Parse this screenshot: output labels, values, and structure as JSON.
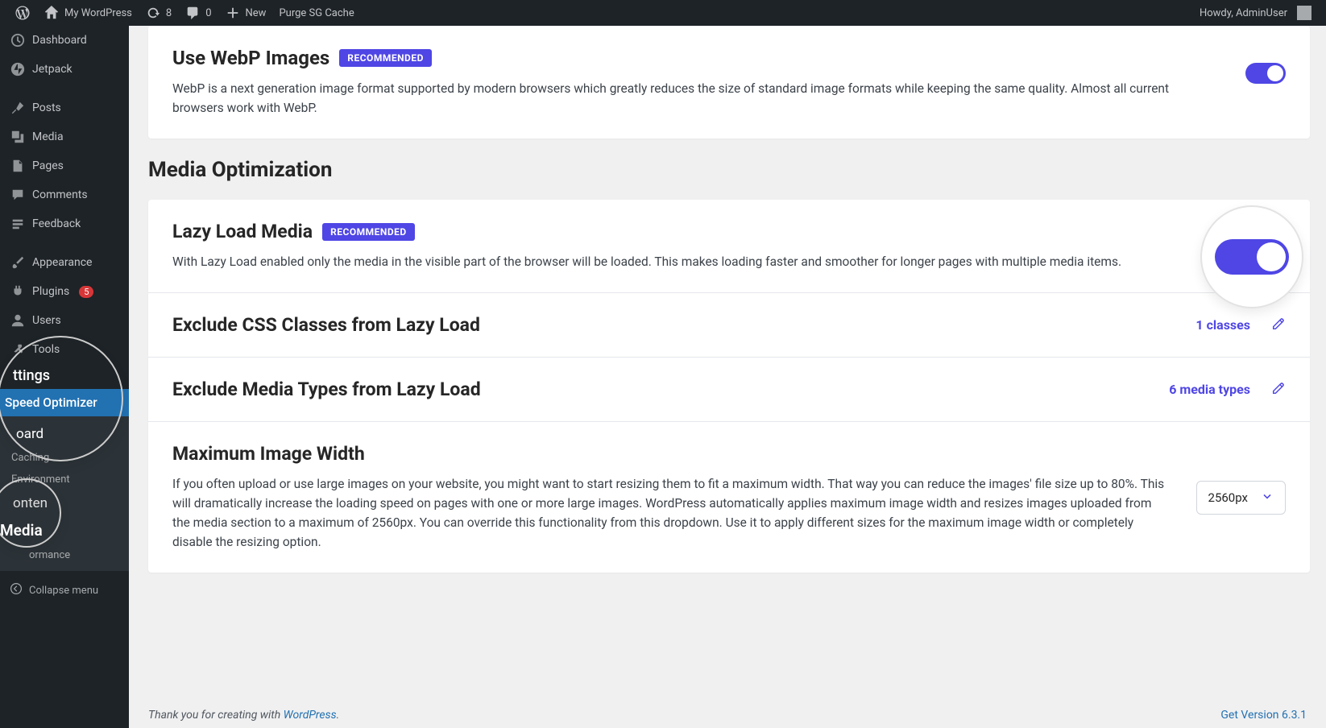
{
  "adminbar": {
    "site_name": "My WordPress",
    "updates_count": "8",
    "comments_count": "0",
    "new_label": "New",
    "purge_label": "Purge SG Cache",
    "howdy": "Howdy, AdminUser"
  },
  "sidebar": {
    "items": [
      {
        "label": "Dashboard"
      },
      {
        "label": "Jetpack"
      },
      {
        "label": "Posts"
      },
      {
        "label": "Media"
      },
      {
        "label": "Pages"
      },
      {
        "label": "Comments"
      },
      {
        "label": "Feedback"
      },
      {
        "label": "Appearance"
      },
      {
        "label": "Plugins",
        "badge": "5"
      },
      {
        "label": "Users"
      },
      {
        "label": "Tools"
      }
    ],
    "speed_label": "Speed Optimizer",
    "sub": {
      "board": "oard",
      "caching": "Caching",
      "environment": "Environment",
      "onten": "onten",
      "media": "Media",
      "ormance": "ormance"
    },
    "collapse": "Collapse menu"
  },
  "cards": {
    "webp_title": "Use WebP Images",
    "recommended": "RECOMMENDED",
    "webp_desc": "WebP is a next generation image format supported by modern browsers which greatly reduces the size of standard image formats while keeping the same quality. Almost all current browsers work with WebP.",
    "section_title": "Media Optimization",
    "lazy_title": "Lazy Load Media",
    "lazy_desc": "With Lazy Load enabled only the media in the visible part of the browser will be loaded. This makes loading faster and smoother for longer pages with multiple media items.",
    "exclude_css_title": "Exclude CSS Classes from Lazy Load",
    "exclude_css_value": "1 classes",
    "exclude_media_title": "Exclude Media Types from Lazy Load",
    "exclude_media_value": "6 media types",
    "max_width_title": "Maximum Image Width",
    "max_width_desc": "If you often upload or use large images on your website, you might want to start resizing them to fit a maximum width. That way you can reduce the images' file size up to 80%. This will dramatically increase the loading speed on pages with one or more large images. WordPress automatically applies maximum image width and resizes images uploaded from the media section to a maximum of 2560px. You can override this functionality from this dropdown. Use it to apply different sizes for the maximum image width or completely disable the resizing option.",
    "max_width_value": "2560px"
  },
  "footer": {
    "thanks": "Thank you for creating with ",
    "wp": "WordPress",
    "period": ".",
    "version": "Get Version 6.3.1"
  }
}
